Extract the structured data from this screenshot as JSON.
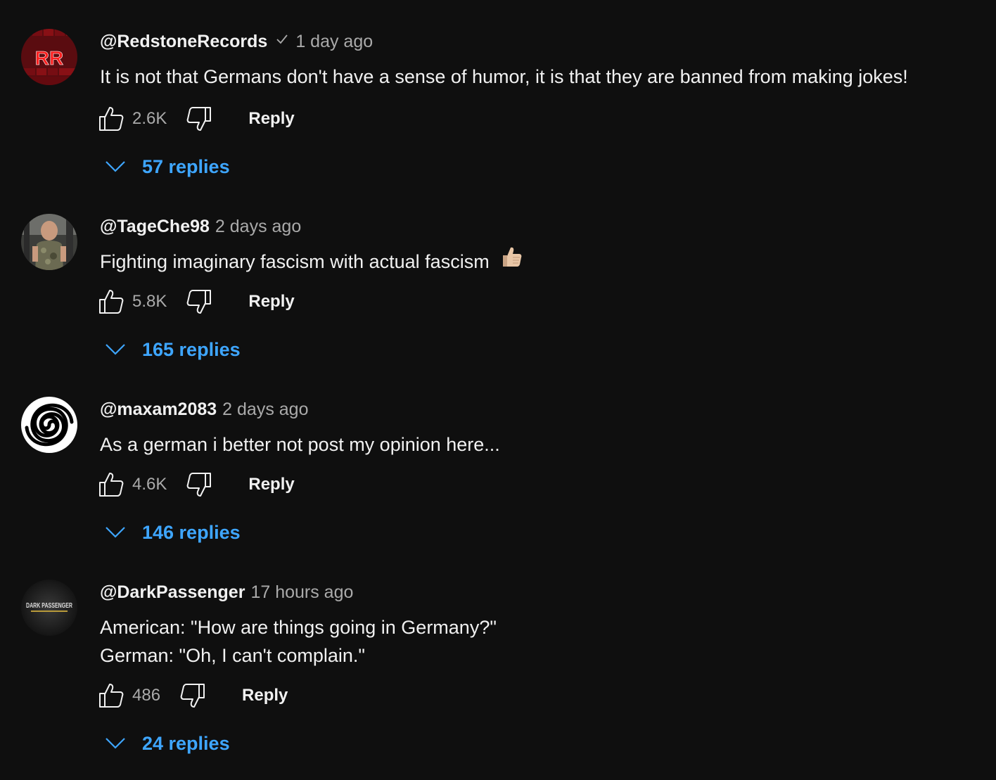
{
  "comments": [
    {
      "author": "@RedstoneRecords",
      "verified": true,
      "time": "1 day ago",
      "text_lines": [
        "It is not that Germans don't have a sense of humor, it is that they are banned from making jokes!"
      ],
      "likes": "2.6K",
      "reply_label": "Reply",
      "replies_label": "57 replies",
      "avatar": {
        "label": "RR",
        "bg": "#a3161d",
        "fg": "#ff2a2a"
      }
    },
    {
      "author": "@TageChe98",
      "verified": false,
      "time": "2 days ago",
      "text_lines": [
        "Fighting imaginary fascism with actual fascism"
      ],
      "emoji": "thumbs-up-light-skin",
      "likes": "5.8K",
      "reply_label": "Reply",
      "replies_label": "165 replies",
      "avatar": {
        "label": "",
        "bg": "#4a4a44",
        "fg": "#8a8a6a"
      }
    },
    {
      "author": "@maxam2083",
      "verified": false,
      "time": "2 days ago",
      "text_lines": [
        "As a german i better not post my opinion here..."
      ],
      "likes": "4.6K",
      "reply_label": "Reply",
      "replies_label": "146 replies",
      "avatar": {
        "label": "",
        "bg": "#ffffff",
        "fg": "#000000"
      }
    },
    {
      "author": "@DarkPassenger",
      "verified": false,
      "time": "17 hours ago",
      "text_lines": [
        "American: \"How are things going in Germany?\"",
        "German: \"Oh, I can't complain.\""
      ],
      "likes": "486",
      "reply_label": "Reply",
      "replies_label": "24 replies",
      "avatar": {
        "label": "DARK PASSENGER",
        "bg": "#1a1a1a",
        "fg": "#cfcfcf"
      }
    }
  ],
  "colors": {
    "background": "#0f0f0f",
    "text_primary": "#f1f1f1",
    "text_secondary": "#aaaaaa",
    "link_blue": "#3ea6ff"
  },
  "icons": {
    "like": "thumbs-up-icon",
    "dislike": "thumbs-down-icon",
    "expand": "chevron-down-icon",
    "verified": "checkmark-icon"
  }
}
